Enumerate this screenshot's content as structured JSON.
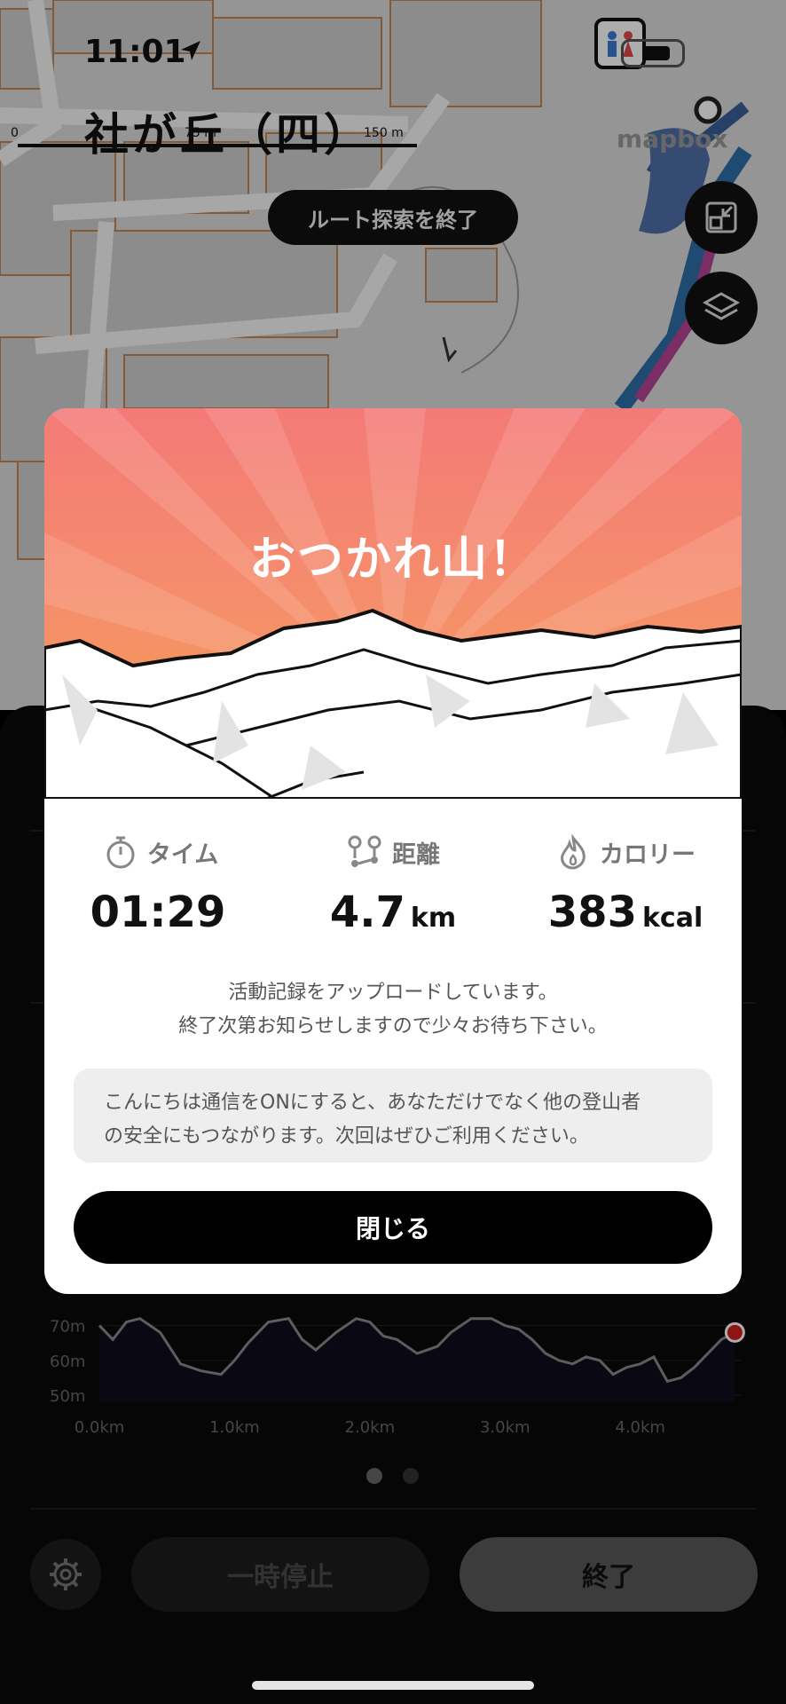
{
  "status_bar": {
    "time": "11:01"
  },
  "map": {
    "place_name": "社が丘（四）",
    "scale": {
      "zero": "0",
      "mid": "75 m",
      "max": "150 m"
    },
    "attribution": "mapbox",
    "route_end_button": "ルート探索を終了"
  },
  "modal": {
    "title": "おつかれ山！",
    "stats": [
      {
        "label": "タイム",
        "value": "01:29",
        "unit": "",
        "icon": "stopwatch-icon"
      },
      {
        "label": "距離",
        "value": "4.7",
        "unit": "km",
        "icon": "route-icon"
      },
      {
        "label": "カロリー",
        "value": "383",
        "unit": "kcal",
        "icon": "flame-icon"
      }
    ],
    "upload_line1": "活動記録をアップロードしています。",
    "upload_line2": "終了次第お知らせしますので少々お待ち下さい。",
    "info_line1": "こんにちは通信をONにすると、あなただけでなく他の登山者",
    "info_line2": "の安全にもつながります。次回はぜひご利用ください。",
    "close_button": "閉じる"
  },
  "chart_data": {
    "type": "area",
    "x": [
      0,
      0.1,
      0.2,
      0.3,
      0.45,
      0.6,
      0.75,
      0.9,
      1.0,
      1.1,
      1.25,
      1.4,
      1.5,
      1.6,
      1.75,
      1.9,
      2.0,
      2.1,
      2.2,
      2.35,
      2.5,
      2.6,
      2.75,
      2.9,
      3.0,
      3.1,
      3.2,
      3.3,
      3.4,
      3.5,
      3.6,
      3.7,
      3.8,
      3.9,
      4.0,
      4.1,
      4.2,
      4.3,
      4.4,
      4.5,
      4.6,
      4.7
    ],
    "y": [
      70,
      66,
      71,
      72,
      68,
      59,
      57,
      56,
      60,
      65,
      71,
      72,
      66,
      63,
      68,
      72,
      71,
      67,
      66,
      62,
      64,
      68,
      72,
      72,
      70,
      69,
      66,
      62,
      60,
      59,
      61,
      60,
      56,
      58,
      59,
      61,
      54,
      55,
      58,
      62,
      66,
      68
    ],
    "y_ticks": [
      "50m",
      "60m",
      "70m"
    ],
    "x_ticks": [
      "0.0km",
      "1.0km",
      "2.0km",
      "3.0km",
      "4.0km"
    ],
    "ylim": [
      48,
      76
    ],
    "xlim": [
      0,
      4.75
    ],
    "colors": {
      "line": "#8a8a8a",
      "fill": "#0f0c1c",
      "end_marker": "#d32020"
    }
  },
  "pager": {
    "active": 0,
    "count": 2
  },
  "controls": {
    "pause": "一時停止",
    "end": "終了"
  }
}
